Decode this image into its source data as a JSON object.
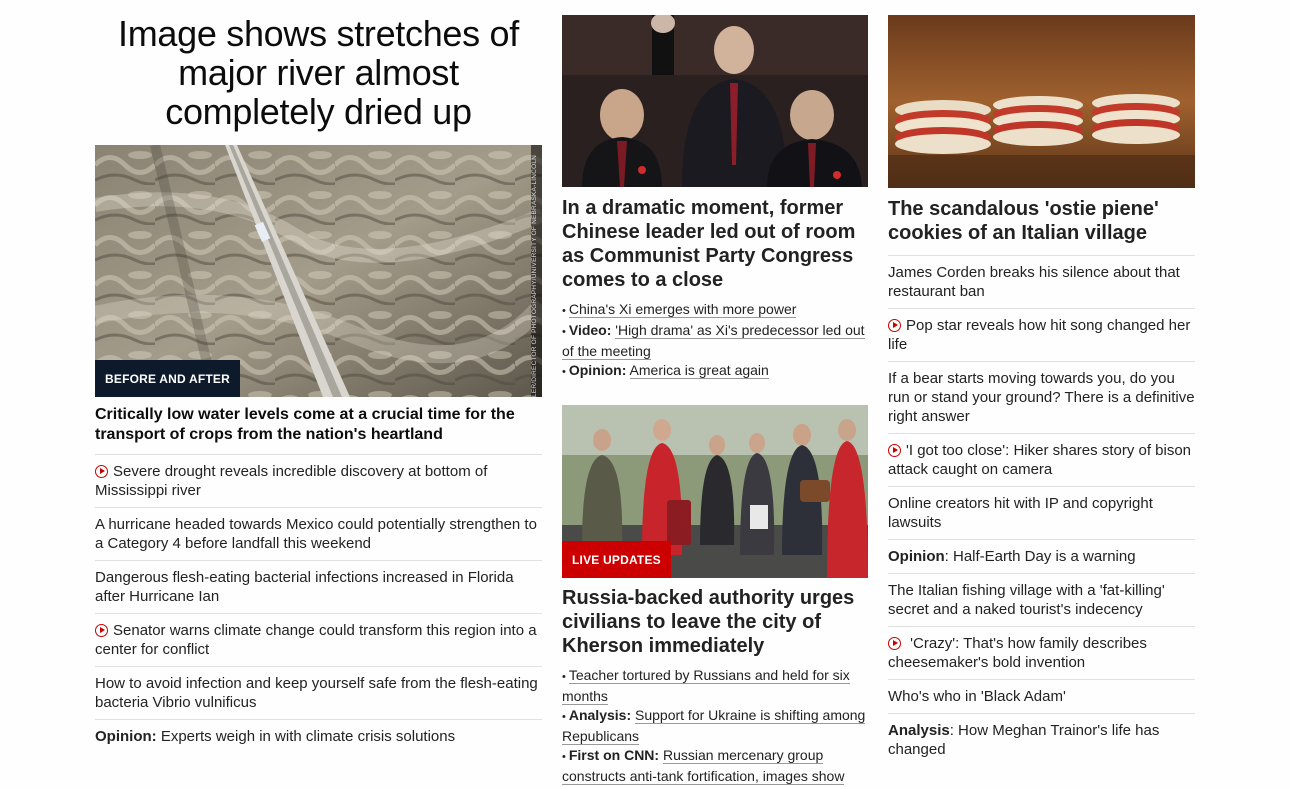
{
  "left": {
    "headline": "Image shows stretches of major river almost completely dried up",
    "image_badge": "BEFORE AND AFTER",
    "image_credit": "LER/DIRECTOR OF PHOTOGRAPHY/UNIVERSITY OF NEBRASKA-LINCOLN",
    "lead_title": "Critically low water levels come at a crucial time for the transport of crops from the nation's heartland",
    "items": [
      {
        "video": true,
        "text": "Severe drought reveals incredible discovery at bottom of Mississippi river"
      },
      {
        "video": false,
        "text": "A hurricane headed towards Mexico could potentially strengthen to a Category 4 before landfall this weekend"
      },
      {
        "video": false,
        "text": "Dangerous flesh-eating bacterial infections increased in Florida after Hurricane Ian"
      },
      {
        "video": true,
        "text": "Senator warns climate change could transform this region into a center for conflict"
      },
      {
        "video": false,
        "text": "How to avoid infection and keep yourself safe from the flesh-eating bacteria Vibrio vulnificus"
      },
      {
        "prefix": "Opinion:",
        "text": "Experts weigh in with climate crisis solutions"
      }
    ]
  },
  "middle": {
    "story1": {
      "title": "In a dramatic moment, former Chinese leader led out of room as Communist Party Congress comes to a close",
      "bullets": [
        {
          "prefix": "",
          "text": "China's Xi emerges with more power"
        },
        {
          "prefix": "Video:",
          "text": "'High drama' as Xi's predecessor led out of the meeting"
        },
        {
          "prefix": "Opinion:",
          "text": "America is great again"
        }
      ]
    },
    "story2": {
      "badge": "LIVE UPDATES",
      "title": "Russia-backed authority urges civilians to leave the city of Kherson immediately",
      "bullets": [
        {
          "prefix": "",
          "text": "Teacher tortured by Russians and held for six months"
        },
        {
          "prefix": "Analysis:",
          "text": "Support for Ukraine is shifting among Republicans"
        },
        {
          "prefix": "First on CNN:",
          "text": "Russian mercenary group constructs anti-tank fortification, images show"
        }
      ]
    }
  },
  "right": {
    "title": "The scandalous 'ostie piene' cookies of an Italian village",
    "items": [
      {
        "text": "James Corden breaks his silence about that restaurant ban"
      },
      {
        "video": true,
        "text": "Pop star reveals how hit song changed her life"
      },
      {
        "text": "If a bear starts moving towards you, do you run or stand your ground? There is a definitive right answer"
      },
      {
        "video": true,
        "text": "'I got too close': Hiker shares story of bison attack caught on camera"
      },
      {
        "text": "Online creators hit with IP and copyright lawsuits"
      },
      {
        "prefix": "Opinion",
        "text": ": Half-Earth Day is a warning"
      },
      {
        "text": "The Italian fishing village with a 'fat-killing' secret and a naked tourist's indecency"
      },
      {
        "video": true,
        "text": " 'Crazy': That's how family describes cheesemaker's bold invention"
      },
      {
        "text": "Who's who in 'Black Adam'"
      },
      {
        "prefix": "Analysis",
        "text": ": How Meghan Trainor's life has changed"
      }
    ]
  },
  "colors": {
    "accent_red": "#cc0000",
    "badge_navy": "#0c1a2b",
    "divider": "#e0e0e0"
  }
}
